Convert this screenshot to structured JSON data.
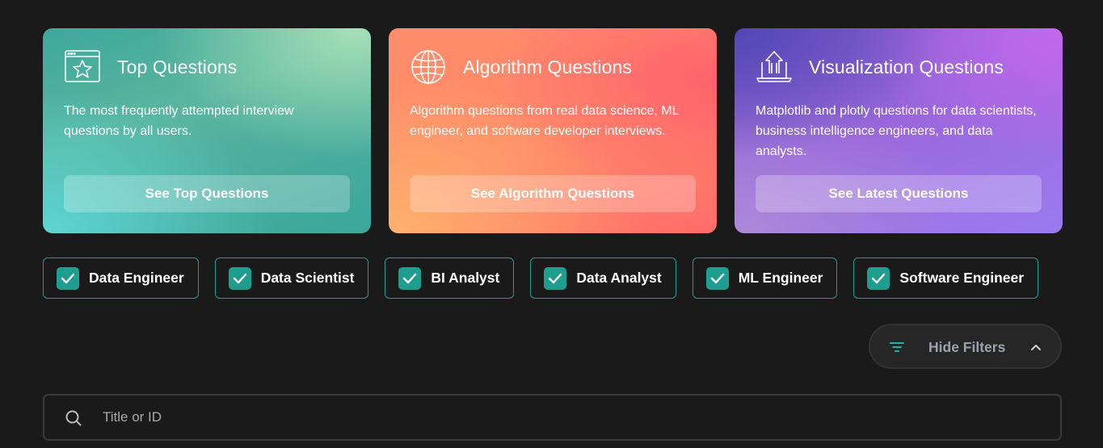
{
  "cards": [
    {
      "icon": "browser-star-icon",
      "title": "Top Questions",
      "description": "The most frequently attempted interview questions by all users.",
      "button": "See Top Questions"
    },
    {
      "icon": "globe-icon",
      "title": "Algorithm Questions",
      "description": "Algorithm questions from real data science, ML engineer, and software developer interviews.",
      "button": "See Algorithm Questions"
    },
    {
      "icon": "laptop-upload-icon",
      "title": "Visualization Questions",
      "description": "Matplotlib and plotly questions for data scientists, business intelligence engineers, and data analysts.",
      "button": "See Latest Questions"
    }
  ],
  "roles": [
    {
      "label": "Data Engineer",
      "checked": true
    },
    {
      "label": "Data Scientist",
      "checked": true
    },
    {
      "label": "BI Analyst",
      "checked": true
    },
    {
      "label": "Data Analyst",
      "checked": true
    },
    {
      "label": "ML Engineer",
      "checked": true
    },
    {
      "label": "Software Engineer",
      "checked": true
    }
  ],
  "filters": {
    "toggle_label": "Hide Filters",
    "icon": "filter-lines-icon",
    "chevron": "chevron-up-icon"
  },
  "search": {
    "placeholder": "Title or ID",
    "value": "",
    "icon": "search-icon"
  },
  "colors": {
    "background": "#1a1a1a",
    "accent": "#1e9e8f"
  }
}
